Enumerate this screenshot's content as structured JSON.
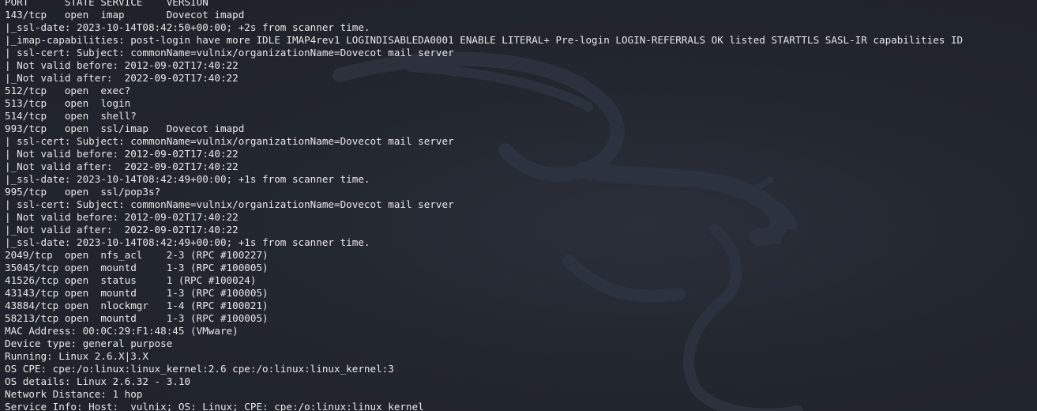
{
  "terminal": {
    "lines": [
      "PORT      STATE SERVICE    VERSION",
      "143/tcp   open  imap       Dovecot imapd",
      "|_ssl-date: 2023-10-14T08:42:50+00:00; +2s from scanner time.",
      "|_imap-capabilities: post-login have more IDLE IMAP4rev1 LOGINDISABLEDA0001 ENABLE LITERAL+ Pre-login LOGIN-REFERRALS OK listed STARTTLS SASL-IR capabilities ID",
      "| ssl-cert: Subject: commonName=vulnix/organizationName=Dovecot mail server",
      "| Not valid before: 2012-09-02T17:40:22",
      "|_Not valid after:  2022-09-02T17:40:22",
      "512/tcp   open  exec?",
      "513/tcp   open  login",
      "514/tcp   open  shell?",
      "993/tcp   open  ssl/imap   Dovecot imapd",
      "| ssl-cert: Subject: commonName=vulnix/organizationName=Dovecot mail server",
      "| Not valid before: 2012-09-02T17:40:22",
      "|_Not valid after:  2022-09-02T17:40:22",
      "|_ssl-date: 2023-10-14T08:42:49+00:00; +1s from scanner time.",
      "995/tcp   open  ssl/pop3s?",
      "| ssl-cert: Subject: commonName=vulnix/organizationName=Dovecot mail server",
      "| Not valid before: 2012-09-02T17:40:22",
      "|_Not valid after:  2022-09-02T17:40:22",
      "|_ssl-date: 2023-10-14T08:42:49+00:00; +1s from scanner time.",
      "2049/tcp  open  nfs_acl    2-3 (RPC #100227)",
      "35045/tcp open  mountd     1-3 (RPC #100005)",
      "41526/tcp open  status     1 (RPC #100024)",
      "43143/tcp open  mountd     1-3 (RPC #100005)",
      "43884/tcp open  nlockmgr   1-4 (RPC #100021)",
      "58213/tcp open  mountd     1-3 (RPC #100005)",
      "MAC Address: 00:0C:29:F1:48:45 (VMware)",
      "Device type: general purpose",
      "Running: Linux 2.6.X|3.X",
      "OS CPE: cpe:/o:linux:linux_kernel:2.6 cpe:/o:linux:linux_kernel:3",
      "OS details: Linux 2.6.32 - 3.10",
      "Network Distance: 1 hop",
      "Service Info: Host:  vulnix; OS: Linux; CPE: cpe:/o:linux:linux_kernel"
    ]
  },
  "theme": {
    "background": "#1f2229",
    "text": "#e8e8e8",
    "watermark": "kali-dragon-icon"
  }
}
